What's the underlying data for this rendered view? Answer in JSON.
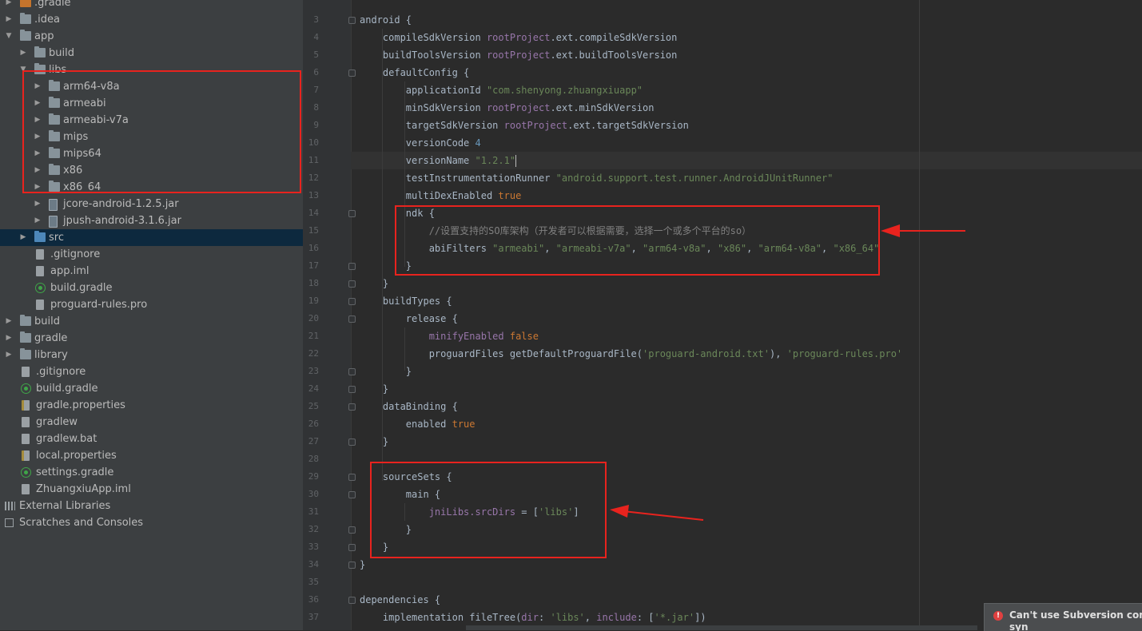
{
  "project_tree": {
    "items": [
      {
        "label": ".gradle",
        "depth": 0,
        "icon": "folder-icon",
        "kind": "folder-orange",
        "arrow": "right"
      },
      {
        "label": ".idea",
        "depth": 0,
        "icon": "folder-icon",
        "kind": "folder",
        "arrow": "right"
      },
      {
        "label": "app",
        "depth": 0,
        "icon": "folder-icon",
        "kind": "folder",
        "arrow": "down"
      },
      {
        "label": "build",
        "depth": 1,
        "icon": "folder-icon",
        "kind": "folder",
        "arrow": "right"
      },
      {
        "label": "libs",
        "depth": 1,
        "icon": "folder-icon",
        "kind": "folder",
        "arrow": "down"
      },
      {
        "label": "arm64-v8a",
        "depth": 2,
        "icon": "folder-icon",
        "kind": "folder",
        "arrow": "right"
      },
      {
        "label": "armeabi",
        "depth": 2,
        "icon": "folder-icon",
        "kind": "folder",
        "arrow": "right"
      },
      {
        "label": "armeabi-v7a",
        "depth": 2,
        "icon": "folder-icon",
        "kind": "folder",
        "arrow": "right"
      },
      {
        "label": "mips",
        "depth": 2,
        "icon": "folder-icon",
        "kind": "folder",
        "arrow": "right"
      },
      {
        "label": "mips64",
        "depth": 2,
        "icon": "folder-icon",
        "kind": "folder",
        "arrow": "right"
      },
      {
        "label": "x86",
        "depth": 2,
        "icon": "folder-icon",
        "kind": "folder",
        "arrow": "right"
      },
      {
        "label": "x86_64",
        "depth": 2,
        "icon": "folder-icon",
        "kind": "folder",
        "arrow": "right"
      },
      {
        "label": "jcore-android-1.2.5.jar",
        "depth": 2,
        "icon": "jar-file-icon",
        "kind": "jar",
        "arrow": "right"
      },
      {
        "label": "jpush-android-3.1.6.jar",
        "depth": 2,
        "icon": "jar-file-icon",
        "kind": "jar",
        "arrow": "right"
      },
      {
        "label": "src",
        "depth": 1,
        "icon": "folder-icon",
        "kind": "folder",
        "arrow": "right",
        "selected": true
      },
      {
        "label": ".gitignore",
        "depth": 1,
        "icon": "text-file-icon",
        "kind": "file",
        "arrow": ""
      },
      {
        "label": "app.iml",
        "depth": 1,
        "icon": "module-file-icon",
        "kind": "file",
        "arrow": ""
      },
      {
        "label": "build.gradle",
        "depth": 1,
        "icon": "gradle-icon",
        "kind": "gradle",
        "arrow": ""
      },
      {
        "label": "proguard-rules.pro",
        "depth": 1,
        "icon": "text-file-icon",
        "kind": "file",
        "arrow": ""
      },
      {
        "label": "build",
        "depth": 0,
        "icon": "folder-icon",
        "kind": "folder",
        "arrow": "right"
      },
      {
        "label": "gradle",
        "depth": 0,
        "icon": "folder-icon",
        "kind": "folder",
        "arrow": "right"
      },
      {
        "label": "library",
        "depth": 0,
        "icon": "folder-icon",
        "kind": "folder",
        "arrow": "right"
      },
      {
        "label": ".gitignore",
        "depth": 0,
        "icon": "text-file-icon",
        "kind": "file",
        "arrow": ""
      },
      {
        "label": "build.gradle",
        "depth": 0,
        "icon": "gradle-icon",
        "kind": "gradle",
        "arrow": ""
      },
      {
        "label": "gradle.properties",
        "depth": 0,
        "icon": "properties-file-icon",
        "kind": "props",
        "arrow": ""
      },
      {
        "label": "gradlew",
        "depth": 0,
        "icon": "text-file-icon",
        "kind": "file",
        "arrow": ""
      },
      {
        "label": "gradlew.bat",
        "depth": 0,
        "icon": "text-file-icon",
        "kind": "file",
        "arrow": ""
      },
      {
        "label": "local.properties",
        "depth": 0,
        "icon": "properties-file-icon",
        "kind": "props",
        "arrow": ""
      },
      {
        "label": "settings.gradle",
        "depth": 0,
        "icon": "gradle-icon",
        "kind": "gradle",
        "arrow": ""
      },
      {
        "label": "ZhuangxiuApp.iml",
        "depth": 0,
        "icon": "module-file-icon",
        "kind": "file",
        "arrow": ""
      },
      {
        "label": "External Libraries",
        "depth": -1,
        "icon": "libraries-icon",
        "kind": "lib",
        "arrow": ""
      },
      {
        "label": "Scratches and Consoles",
        "depth": -1,
        "icon": "scratches-icon",
        "kind": "scratch",
        "arrow": ""
      }
    ]
  },
  "editor": {
    "current_line": 11,
    "lines": [
      {
        "n": "3",
        "fold": true,
        "segs": [
          [
            "",
            "android {"
          ]
        ]
      },
      {
        "n": "4",
        "segs": [
          [
            "",
            "    compileSdkVersion "
          ],
          [
            "p",
            "rootProject"
          ],
          [
            "",
            ".ext.compileSdkVersion"
          ]
        ]
      },
      {
        "n": "5",
        "segs": [
          [
            "",
            "    buildToolsVersion "
          ],
          [
            "p",
            "rootProject"
          ],
          [
            "",
            ".ext.buildToolsVersion"
          ]
        ]
      },
      {
        "n": "6",
        "fold": true,
        "segs": [
          [
            "",
            "    defaultConfig {"
          ]
        ]
      },
      {
        "n": "7",
        "segs": [
          [
            "",
            "        applicationId "
          ],
          [
            "s",
            "\"com.shenyong.zhuangxiuapp\""
          ]
        ]
      },
      {
        "n": "8",
        "segs": [
          [
            "",
            "        minSdkVersion "
          ],
          [
            "p",
            "rootProject"
          ],
          [
            "",
            ".ext.minSdkVersion"
          ]
        ]
      },
      {
        "n": "9",
        "segs": [
          [
            "",
            "        targetSdkVersion "
          ],
          [
            "p",
            "rootProject"
          ],
          [
            "",
            ".ext.targetSdkVersion"
          ]
        ]
      },
      {
        "n": "10",
        "segs": [
          [
            "",
            "        versionCode "
          ],
          [
            "n",
            "4"
          ]
        ]
      },
      {
        "n": "11",
        "segs": [
          [
            "",
            "        versionName "
          ],
          [
            "s",
            "\"1.2.1\""
          ],
          [
            "caret",
            ""
          ]
        ]
      },
      {
        "n": "12",
        "segs": [
          [
            "",
            "        testInstrumentationRunner "
          ],
          [
            "s",
            "\"android.support.test.runner.AndroidJUnitRunner\""
          ]
        ]
      },
      {
        "n": "13",
        "segs": [
          [
            "",
            "        multiDexEnabled "
          ],
          [
            "k",
            "true"
          ]
        ]
      },
      {
        "n": "14",
        "fold": true,
        "segs": [
          [
            "",
            "        ndk {"
          ]
        ]
      },
      {
        "n": "15",
        "segs": [
          [
            "c",
            "            //设置支持的SO库架构（开发者可以根据需要，选择一个或多个平台的so）"
          ]
        ]
      },
      {
        "n": "16",
        "segs": [
          [
            "",
            "            abiFilters "
          ],
          [
            "s",
            "\"armeabi\""
          ],
          [
            "",
            ", "
          ],
          [
            "s",
            "\"armeabi-v7a\""
          ],
          [
            "",
            ", "
          ],
          [
            "s",
            "\"arm64-v8a\""
          ],
          [
            "",
            ", "
          ],
          [
            "s",
            "\"x86\""
          ],
          [
            "",
            ", "
          ],
          [
            "s",
            "\"arm64-v8a\""
          ],
          [
            "",
            ", "
          ],
          [
            "s",
            "\"x86_64\""
          ]
        ]
      },
      {
        "n": "17",
        "fold": true,
        "segs": [
          [
            "",
            "        }"
          ]
        ]
      },
      {
        "n": "18",
        "fold": true,
        "segs": [
          [
            "",
            "    }"
          ]
        ]
      },
      {
        "n": "19",
        "fold": true,
        "segs": [
          [
            "",
            "    buildTypes {"
          ]
        ]
      },
      {
        "n": "20",
        "fold": true,
        "segs": [
          [
            "",
            "        release {"
          ]
        ]
      },
      {
        "n": "21",
        "segs": [
          [
            "",
            "            "
          ],
          [
            "p",
            "minifyEnabled "
          ],
          [
            "k",
            "false"
          ]
        ]
      },
      {
        "n": "22",
        "segs": [
          [
            "",
            "            proguardFiles getDefaultProguardFile("
          ],
          [
            "s",
            "'proguard-android.txt'"
          ],
          [
            "",
            "), "
          ],
          [
            "s",
            "'proguard-rules.pro'"
          ]
        ]
      },
      {
        "n": "23",
        "fold": true,
        "segs": [
          [
            "",
            "        }"
          ]
        ]
      },
      {
        "n": "24",
        "fold": true,
        "segs": [
          [
            "",
            "    }"
          ]
        ]
      },
      {
        "n": "25",
        "fold": true,
        "segs": [
          [
            "",
            "    dataBinding {"
          ]
        ]
      },
      {
        "n": "26",
        "segs": [
          [
            "",
            "        enabled "
          ],
          [
            "k",
            "true"
          ]
        ]
      },
      {
        "n": "27",
        "fold": true,
        "segs": [
          [
            "",
            "    }"
          ]
        ]
      },
      {
        "n": "28",
        "segs": [
          [
            "",
            ""
          ]
        ]
      },
      {
        "n": "29",
        "fold": true,
        "segs": [
          [
            "",
            "    sourceSets {"
          ]
        ]
      },
      {
        "n": "30",
        "fold": true,
        "segs": [
          [
            "",
            "        main {"
          ]
        ]
      },
      {
        "n": "31",
        "segs": [
          [
            "",
            "            "
          ],
          [
            "p",
            "jniLibs.srcDirs"
          ],
          [
            "",
            " = ["
          ],
          [
            "s",
            "'libs'"
          ],
          [
            "",
            "]"
          ]
        ]
      },
      {
        "n": "32",
        "fold": true,
        "segs": [
          [
            "",
            "        }"
          ]
        ]
      },
      {
        "n": "33",
        "fold": true,
        "segs": [
          [
            "",
            "    }"
          ]
        ]
      },
      {
        "n": "34",
        "fold": true,
        "segs": [
          [
            "",
            "}"
          ]
        ]
      },
      {
        "n": "35",
        "segs": [
          [
            "",
            ""
          ]
        ]
      },
      {
        "n": "36",
        "fold": true,
        "segs": [
          [
            "",
            "dependencies {"
          ]
        ]
      },
      {
        "n": "37",
        "segs": [
          [
            "",
            "    implementation fileTree("
          ],
          [
            "p",
            "dir"
          ],
          [
            "",
            ": "
          ],
          [
            "s",
            "'libs'"
          ],
          [
            "",
            ", "
          ],
          [
            "p",
            "include"
          ],
          [
            "",
            ": ["
          ],
          [
            "s",
            "'*.jar'"
          ],
          [
            "",
            "])"
          ]
        ]
      }
    ]
  },
  "notification": {
    "icon": "error-icon",
    "text": "Can't use Subversion comm",
    "text2": "syn"
  },
  "colors": {
    "annotation_red": "#e8231e",
    "selection": "#0d293e",
    "string": "#6a8759",
    "keyword": "#cc7832",
    "property": "#9876aa",
    "number": "#6897bb"
  }
}
